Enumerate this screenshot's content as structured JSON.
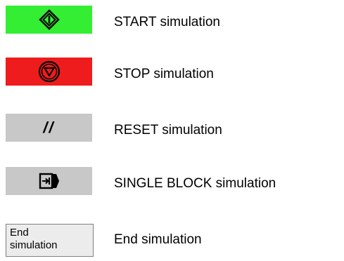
{
  "buttons": {
    "start": {
      "icon": "start-diamond-icon",
      "color": "#33ee33",
      "label": "START simulation"
    },
    "stop": {
      "icon": "stop-triangle-icon",
      "color": "#ee1c1c",
      "label": "STOP simulation"
    },
    "reset": {
      "icon_text": "//",
      "color": "#c8c8c8",
      "label": "RESET simulation"
    },
    "single_block": {
      "icon": "single-block-icon",
      "color": "#c8c8c8",
      "label": "SINGLE BLOCK simulation"
    },
    "end": {
      "line1": "End",
      "line2": "simulation",
      "label": "End simulation"
    }
  }
}
